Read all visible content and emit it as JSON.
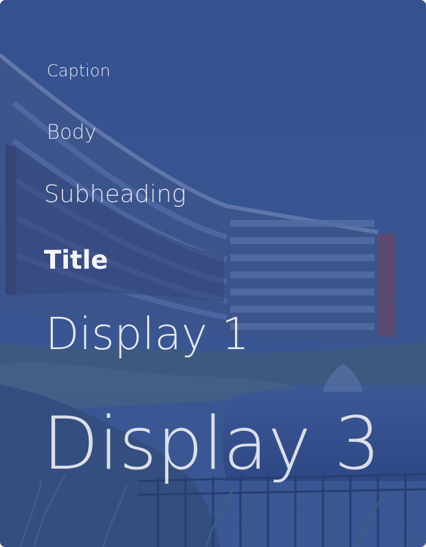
{
  "colors": {
    "overlay": "#2f4a86",
    "sky": "#3d5c9b",
    "text": "#ffffff"
  },
  "typography": {
    "caption": "Caption",
    "body": "Body",
    "subheading": "Subheading",
    "title": "Title",
    "display1": "Display 1",
    "display3": "Display 3"
  }
}
